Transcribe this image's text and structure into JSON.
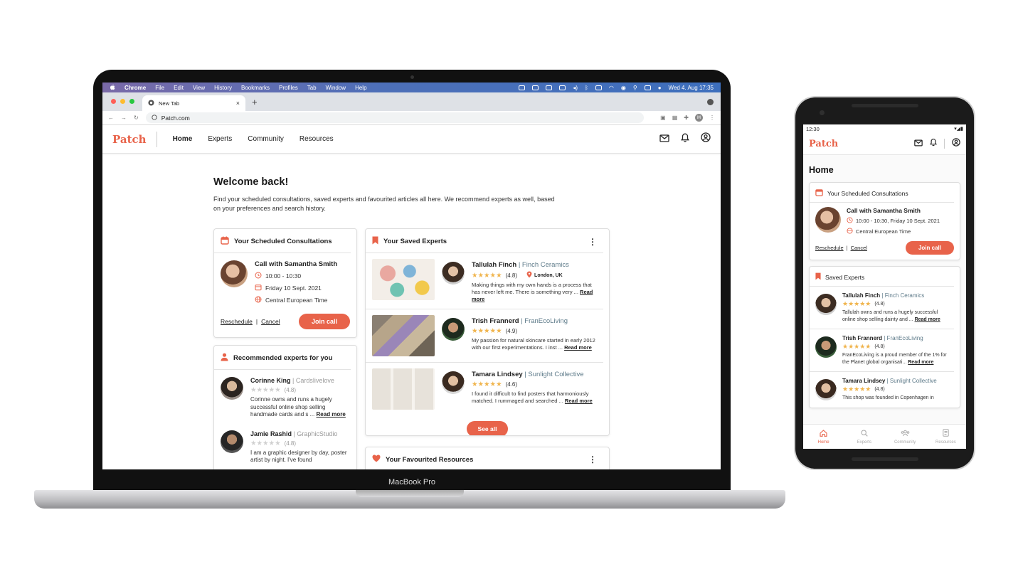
{
  "device_label": "MacBook Pro",
  "menubar": {
    "apple": "",
    "items": [
      "Chrome",
      "File",
      "Edit",
      "View",
      "History",
      "Bookmarks",
      "Profiles",
      "Tab",
      "Window",
      "Help"
    ],
    "clock": "Wed 4. Aug  17:35"
  },
  "browser": {
    "tab_title": "New Tab",
    "tab_close": "×",
    "new_tab": "+",
    "url": "Patch.com",
    "profile_initial": "M"
  },
  "site": {
    "logo": "Patch",
    "nav": [
      "Home",
      "Experts",
      "Community",
      "Resources"
    ],
    "welcome_title": "Welcome back!",
    "welcome_text": "Find your scheduled consultations, saved experts and favourited articles all here. We recommend experts as well, based on your preferences and search history."
  },
  "consultations": {
    "title": "Your Scheduled Consultations",
    "call_name": "Call with Samantha Smith",
    "time": "10:00 - 10:30",
    "date": "Friday 10 Sept. 2021",
    "timezone": "Central European Time",
    "reschedule": "Reschedule",
    "separator": "|",
    "cancel": "Cancel",
    "join": "Join call"
  },
  "recommended": {
    "title": "Recommended experts for you",
    "items": [
      {
        "name": "Corinne King",
        "brand": "| Cardslivelove",
        "rating": "(4.8)",
        "desc": "Corinne owns and runs a hugely successful online shop selling handmade cards and s ...",
        "more": "Read more"
      },
      {
        "name": "Jamie Rashid",
        "brand": "| GraphicStudio",
        "rating": "(4.8)",
        "desc": "I am a graphic designer by day, poster artist by night. I've found",
        "more": ""
      }
    ]
  },
  "saved": {
    "title": "Your Saved Experts",
    "kebab": "⋮",
    "items": [
      {
        "name": "Tallulah Finch",
        "brand": "| Finch Ceramics",
        "rating": "(4.8)",
        "location": "London, UK",
        "desc": "Making things with my own hands is a process that has never left me. There is something very ...",
        "more": "Read more"
      },
      {
        "name": "Trish Frannerd",
        "brand": "| FranEcoLiving",
        "rating": "(4.9)",
        "location": "",
        "desc": "My passion for natural skincare started in early 2012 with our first experimentations. I inst ...",
        "more": "Read more"
      },
      {
        "name": "Tamara Lindsey",
        "brand": "| Sunlight Collective",
        "rating": "(4.6)",
        "location": "",
        "desc": "I found it difficult to find posters that harmoniously matched. I rummaged and searched ...",
        "more": "Read more"
      }
    ],
    "see_all": "See all"
  },
  "favourites": {
    "title": "Your Favourited Resources",
    "kebab": "⋮"
  },
  "phone": {
    "time": "12:30",
    "status_icons": "▾◢▮",
    "logo": "Patch",
    "page_title": "Home",
    "consultations": {
      "title": "Your Scheduled Consultations",
      "call_name": "Call with Samantha Smith",
      "time": "10:00 - 10:30, Friday 10 Sept. 2021",
      "timezone": "Central European Time",
      "reschedule": "Reschedule",
      "separator": "|",
      "cancel": "Cancel",
      "join": "Join call"
    },
    "saved": {
      "title": "Saved Experts",
      "items": [
        {
          "name": "Tallulah Finch",
          "brand": "| Finch Ceramics",
          "rating": "(4.8)",
          "desc": "Tallulah owns and runs a hugely successful online shop selling dainty and ...",
          "more": "Read more"
        },
        {
          "name": "Trish Frannerd",
          "brand": "| FranEcoLiving",
          "rating": "(4.8)",
          "desc": "FranEcoLiving is a proud member of the 1% for the Planet global organisati...",
          "more": "Read more"
        },
        {
          "name": "Tamara Lindsey",
          "brand": "| Sunlight Collective",
          "rating": "(4.8)",
          "desc": "This shop was founded in Copenhagen in",
          "more": ""
        }
      ]
    },
    "bottom_nav": [
      "Home",
      "Experts",
      "Community",
      "Resources"
    ]
  },
  "stars_glyph": "★★★★★",
  "colors": {
    "accent": "#e8634a",
    "star": "#f0b44c",
    "brand_text": "#5d7a89"
  }
}
